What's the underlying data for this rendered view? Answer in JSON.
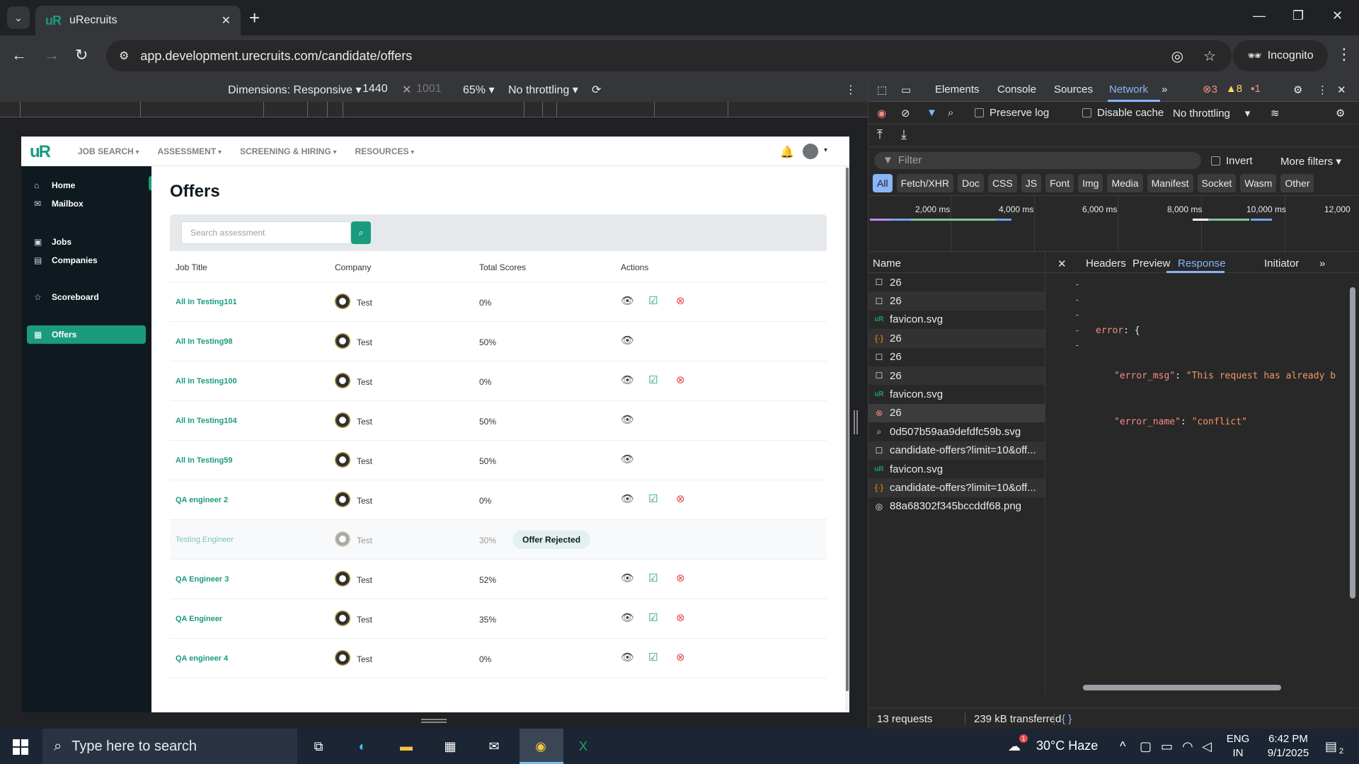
{
  "browser": {
    "tab_title": "uRecruits",
    "url": "app.development.urecruits.com/candidate/offers",
    "incognito_label": "Incognito"
  },
  "device_toolbar": {
    "dimensions_label": "Dimensions: Responsive",
    "width": "1440",
    "height": "1001",
    "zoom": "65%",
    "throttling": "No throttling"
  },
  "app": {
    "logo": "uR",
    "nav": [
      "JOB SEARCH",
      "ASSESSMENT",
      "SCREENING & HIRING",
      "RESOURCES"
    ],
    "sidebar": [
      {
        "label": "Home",
        "icon": "home-icon"
      },
      {
        "label": "Mailbox",
        "icon": "mail-icon"
      },
      {
        "label": "Jobs",
        "icon": "briefcase-icon"
      },
      {
        "label": "Companies",
        "icon": "building-icon"
      },
      {
        "label": "Scoreboard",
        "icon": "star-icon"
      },
      {
        "label": "Offers",
        "icon": "document-icon",
        "active": true
      }
    ],
    "page_title": "Offers",
    "search_placeholder": "Search assessment",
    "columns": [
      "Job Title",
      "Company",
      "Total Scores",
      "Actions"
    ],
    "rows": [
      {
        "title": "All In Testing101",
        "company": "Test",
        "score": "0%",
        "actions": "view-accept-reject"
      },
      {
        "title": "All In Testing98",
        "company": "Test",
        "score": "50%",
        "actions": "view"
      },
      {
        "title": "All In Testing100",
        "company": "Test",
        "score": "0%",
        "actions": "view-accept-reject"
      },
      {
        "title": "All In Testing104",
        "company": "Test",
        "score": "50%",
        "actions": "view"
      },
      {
        "title": "All In Testing59",
        "company": "Test",
        "score": "50%",
        "actions": "view"
      },
      {
        "title": "QA engineer 2",
        "company": "Test",
        "score": "0%",
        "actions": "view-accept-reject"
      },
      {
        "title": "Testing Engineer",
        "company": "Test",
        "score": "30%",
        "actions": "badge",
        "badge": "Offer Rejected"
      },
      {
        "title": "QA Engineer 3",
        "company": "Test",
        "score": "52%",
        "actions": "view-accept-reject"
      },
      {
        "title": "QA Engineer",
        "company": "Test",
        "score": "35%",
        "actions": "view-accept-reject"
      },
      {
        "title": "QA engineer 4",
        "company": "Test",
        "score": "0%",
        "actions": "view-accept-reject"
      }
    ]
  },
  "devtools": {
    "tabs": [
      "Elements",
      "Console",
      "Sources",
      "Network"
    ],
    "selected_tab": "Network",
    "errors": "3",
    "warnings": "8",
    "issues": "1",
    "preserve_log": "Preserve log",
    "disable_cache": "Disable cache",
    "throttling": "No throttling",
    "filter_placeholder": "Filter",
    "invert": "Invert",
    "more_filters": "More filters",
    "type_filters": [
      "All",
      "Fetch/XHR",
      "Doc",
      "CSS",
      "JS",
      "Font",
      "Img",
      "Media",
      "Manifest",
      "Socket",
      "Wasm",
      "Other"
    ],
    "timeline_labels": [
      "2,000 ms",
      "4,000 ms",
      "6,000 ms",
      "8,000 ms",
      "10,000 ms",
      "12,000"
    ],
    "name_header": "Name",
    "requests": [
      {
        "name": "26",
        "icon": "doc"
      },
      {
        "name": "26",
        "icon": "doc"
      },
      {
        "name": "favicon.svg",
        "icon": "favicon"
      },
      {
        "name": "26",
        "icon": "xhr"
      },
      {
        "name": "26",
        "icon": "doc"
      },
      {
        "name": "26",
        "icon": "doc"
      },
      {
        "name": "favicon.svg",
        "icon": "favicon"
      },
      {
        "name": "26",
        "icon": "error",
        "selected": true
      },
      {
        "name": "0d507b59aa9defdfc59b.svg",
        "icon": "search"
      },
      {
        "name": "candidate-offers?limit=10&off...",
        "icon": "doc"
      },
      {
        "name": "favicon.svg",
        "icon": "favicon"
      },
      {
        "name": "candidate-offers?limit=10&off...",
        "icon": "xhr"
      },
      {
        "name": "88a68302f345bccddf68.png",
        "icon": "image"
      }
    ],
    "detail_tabs": [
      "Headers",
      "Preview",
      "Response",
      "Initiator"
    ],
    "selected_detail_tab": "Response",
    "response_lines": [
      {
        "key": "error",
        "rest": ": {"
      },
      {
        "key": "\"error_msg\"",
        "rest": ": ",
        "value": "\"This request has already b"
      },
      {
        "key": "\"error_name\"",
        "rest": ": ",
        "value": "\"conflict\""
      }
    ],
    "requests_count": "13 requests",
    "transferred": "239 kB transferred",
    "braces": "{ }"
  },
  "taskbar": {
    "search_placeholder": "Type here to search",
    "weather": "30°C  Haze",
    "weather_badge": "1",
    "lang_top": "ENG",
    "lang_bottom": "IN",
    "time": "6:42 PM",
    "date": "9/1/2025",
    "notif_count": "2"
  }
}
